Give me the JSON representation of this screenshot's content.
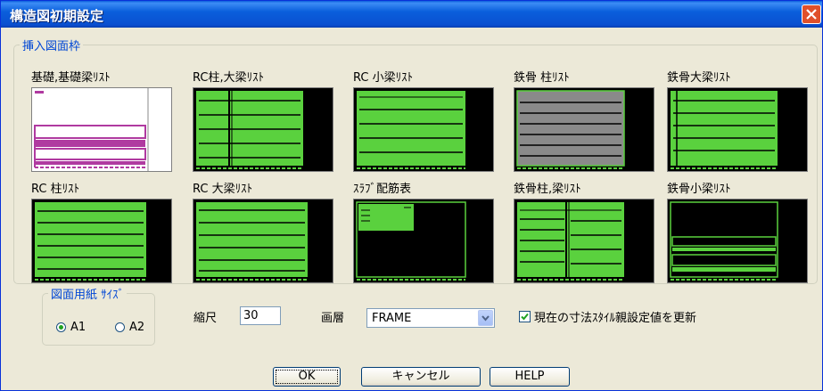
{
  "window": {
    "title": "構造図初期設定"
  },
  "frame_group": {
    "label": "挿入図面枠",
    "items": [
      {
        "label": "基礎,基礎梁ﾘｽﾄ"
      },
      {
        "label": "RC柱,大梁ﾘｽﾄ"
      },
      {
        "label": "RC 小梁ﾘｽﾄ"
      },
      {
        "label": "鉄骨 柱ﾘｽﾄ"
      },
      {
        "label": "鉄骨大梁ﾘｽﾄ"
      },
      {
        "label": "RC 柱ﾘｽﾄ"
      },
      {
        "label": "RC 大梁ﾘｽﾄ"
      },
      {
        "label": "ｽﾗﾌﾞ配筋表"
      },
      {
        "label": "鉄骨柱,梁ﾘｽﾄ"
      },
      {
        "label": "鉄骨小梁ﾘｽﾄ"
      }
    ]
  },
  "paper_group": {
    "label": "図面用紙 ｻｲｽﾞ",
    "options": [
      {
        "label": "A1",
        "selected": true
      },
      {
        "label": "A2",
        "selected": false
      }
    ]
  },
  "scale": {
    "label": "縮尺",
    "value": "30"
  },
  "layer": {
    "label": "画層",
    "value": "FRAME"
  },
  "update_dim": {
    "label": "現在の寸法ｽﾀｲﾙ親設定値を更新",
    "checked": true
  },
  "buttons": {
    "ok": "OK",
    "cancel": "キャンセル",
    "help": "HELP"
  },
  "colors": {
    "title_bar": "#0a5fdc",
    "thumb_green": "#5ad13e",
    "thumb_magenta": "#b03aa0",
    "thumb_gray": "#8a8a8a",
    "dialog_bg": "#ece9d8"
  }
}
